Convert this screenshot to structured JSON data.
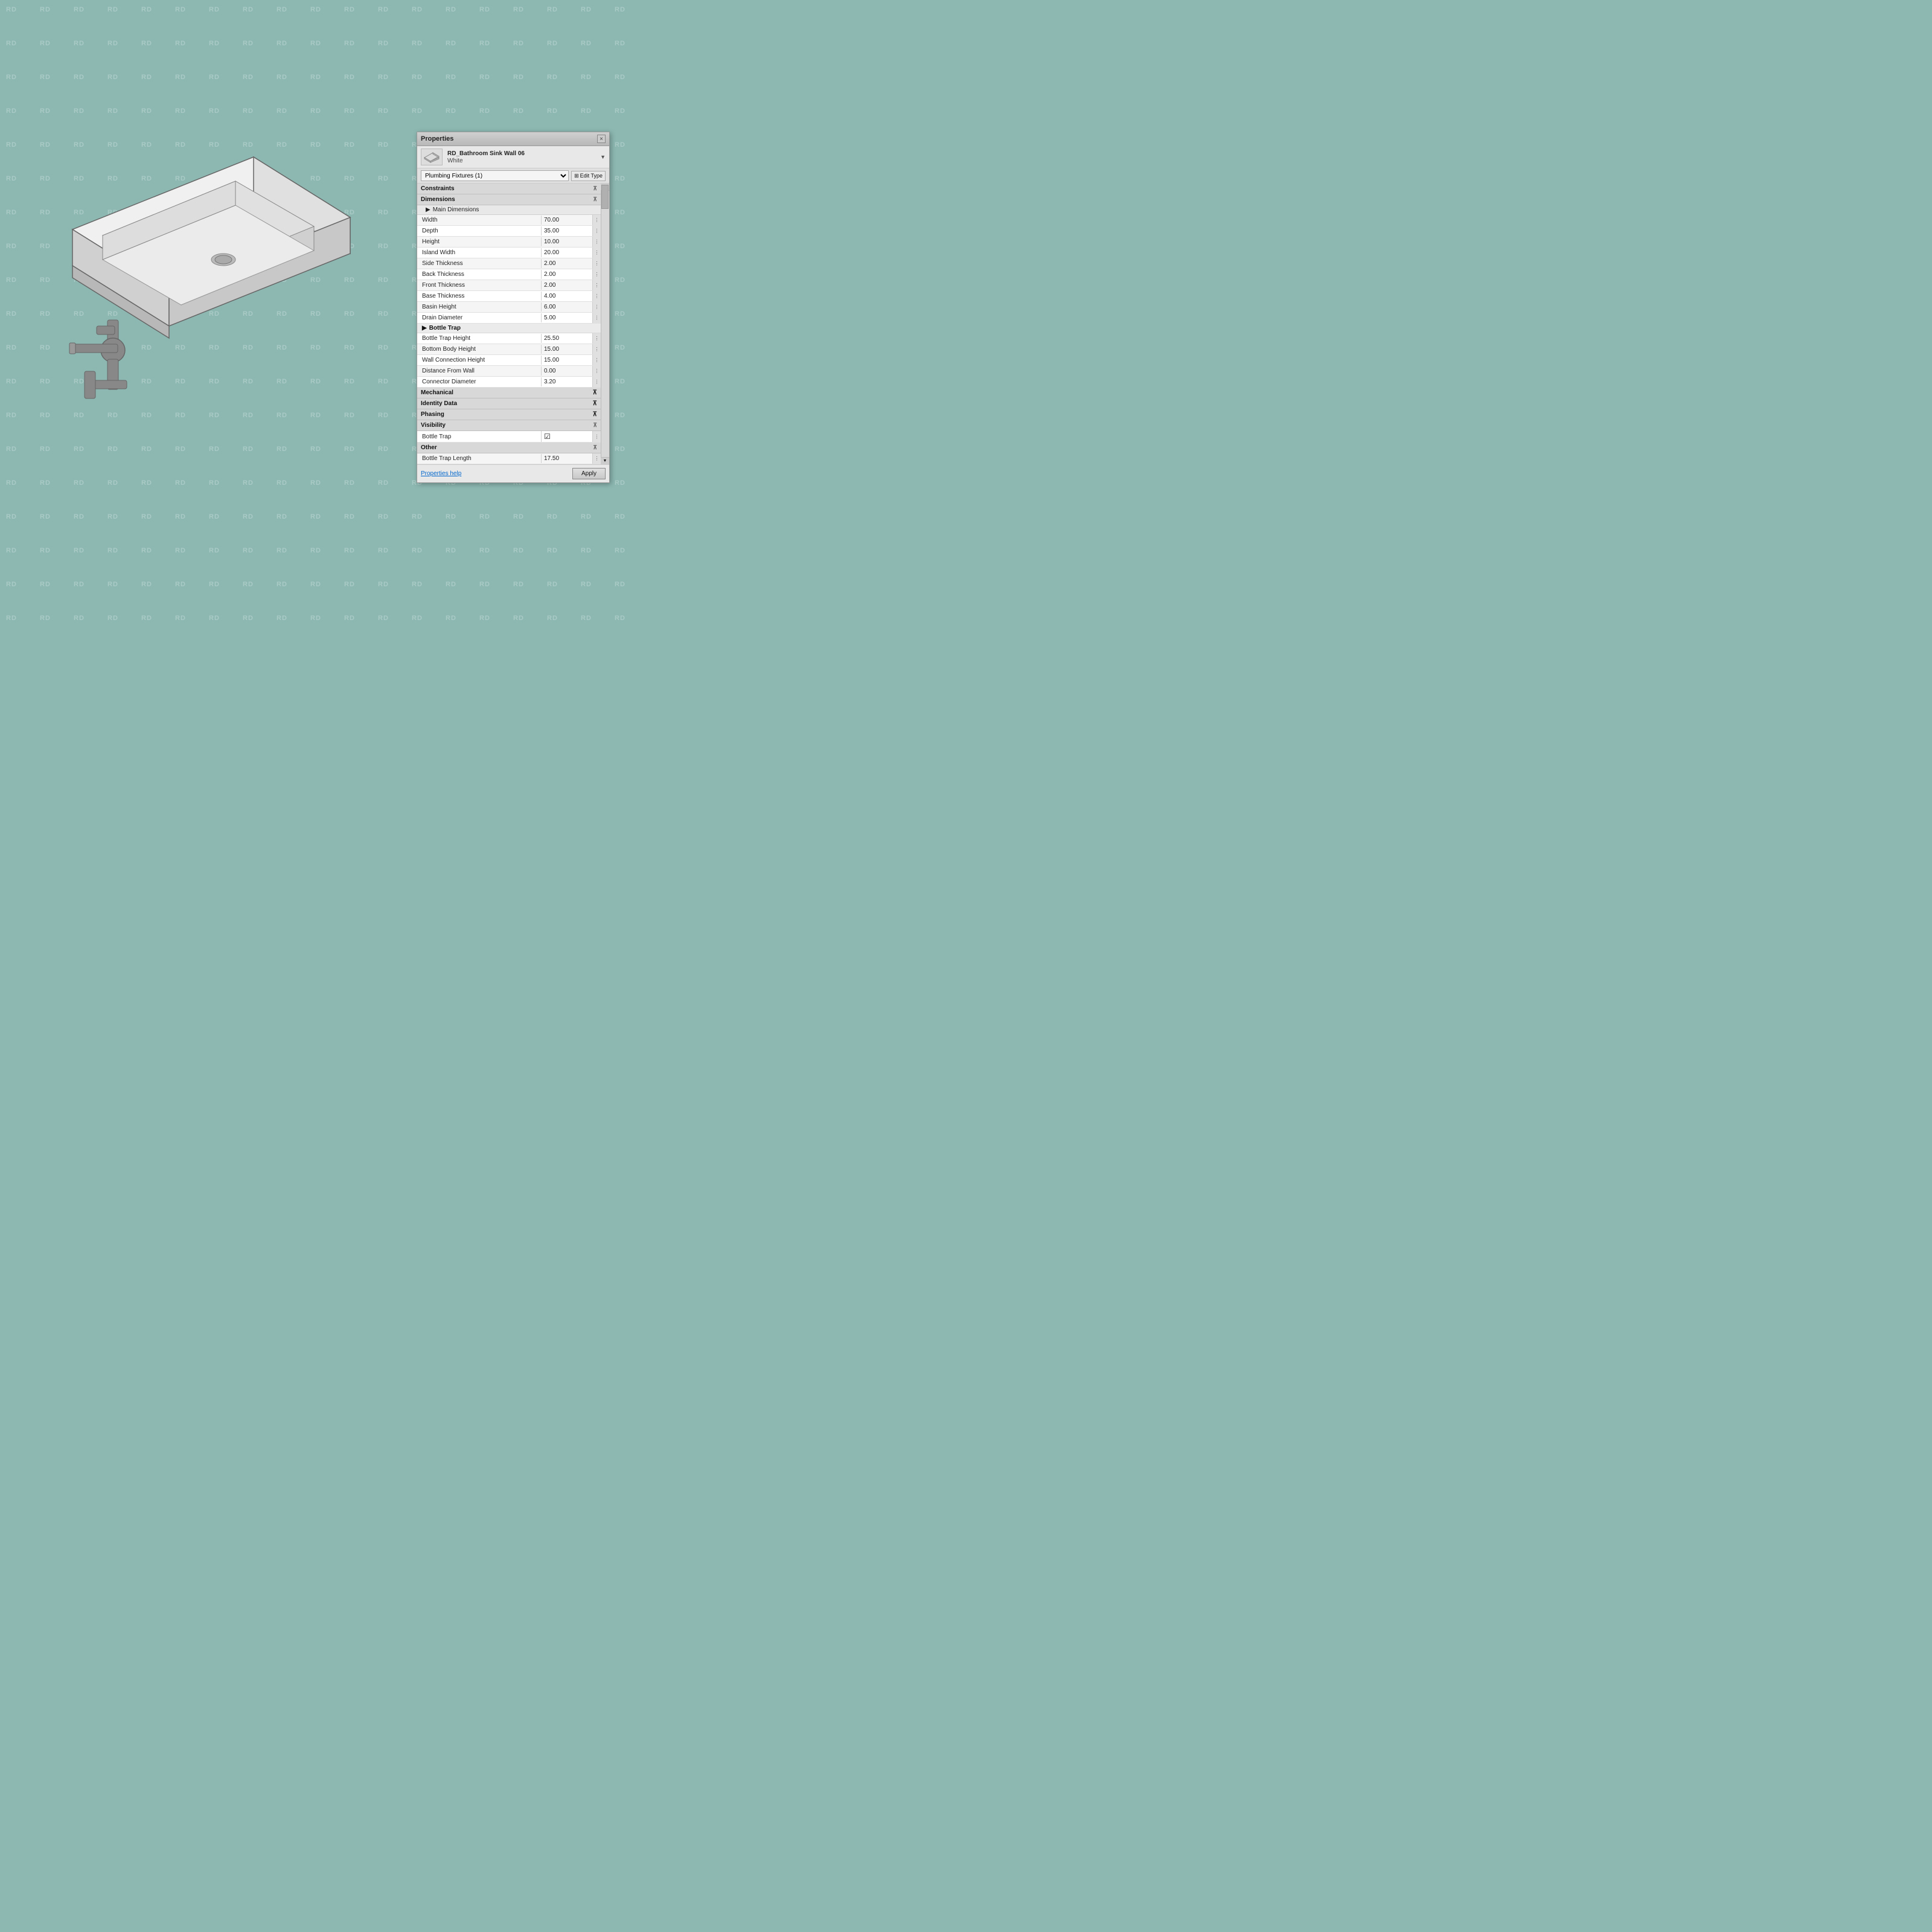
{
  "background": {
    "color": "#8db8b2",
    "watermark_text": "RD"
  },
  "panel": {
    "title": "Properties",
    "close_button_label": "×",
    "object": {
      "name": "RD_Bathroom Sink Wall 06",
      "color": "White"
    },
    "type_selector": {
      "value": "Plumbing Fixtures (1)",
      "options": [
        "Plumbing Fixtures (1)"
      ]
    },
    "edit_type_button": "Edit Type",
    "sections": [
      {
        "id": "constraints",
        "label": "Constraints",
        "collapsed": true
      },
      {
        "id": "dimensions",
        "label": "Dimensions",
        "collapsed": false,
        "subsections": [
          {
            "id": "main-dimensions",
            "label": "Main Dimensions",
            "collapsed": true
          }
        ],
        "properties": [
          {
            "label": "Width",
            "value": "70.00"
          },
          {
            "label": "Depth",
            "value": "35.00"
          },
          {
            "label": "Height",
            "value": "10.00"
          },
          {
            "label": "Island Width",
            "value": "20.00"
          },
          {
            "label": "Side Thickness",
            "value": "2.00"
          },
          {
            "label": "Back Thickness",
            "value": "2.00"
          },
          {
            "label": "Front Thickness",
            "value": "2.00"
          },
          {
            "label": "Base Thickness",
            "value": "4.00"
          },
          {
            "label": "Basin Height",
            "value": "6.00"
          },
          {
            "label": "Drain Diameter",
            "value": "5.00"
          }
        ]
      }
    ],
    "bottle_trap_group": {
      "label": "Bottle Trap",
      "properties": [
        {
          "label": "Bottle Trap Height",
          "value": "25.50"
        },
        {
          "label": "Bottom Body Height",
          "value": "15.00"
        },
        {
          "label": "Wall Connection Height",
          "value": "15.00"
        },
        {
          "label": "Distance From Wall",
          "value": "0.00"
        },
        {
          "label": "Connector Diameter",
          "value": "3.20"
        }
      ]
    },
    "collapsed_sections": [
      {
        "id": "mechanical",
        "label": "Mechanical"
      },
      {
        "id": "identity-data",
        "label": "Identity Data"
      },
      {
        "id": "phasing",
        "label": "Phasing"
      }
    ],
    "visibility_section": {
      "label": "Visibility",
      "properties": [
        {
          "label": "Bottle Trap",
          "value": "☑",
          "type": "checkbox"
        }
      ]
    },
    "other_section": {
      "label": "Other",
      "properties": [
        {
          "label": "Bottle Trap Length",
          "value": "17.50"
        }
      ]
    },
    "footer": {
      "help_link": "Properties help",
      "apply_button": "Apply"
    }
  }
}
